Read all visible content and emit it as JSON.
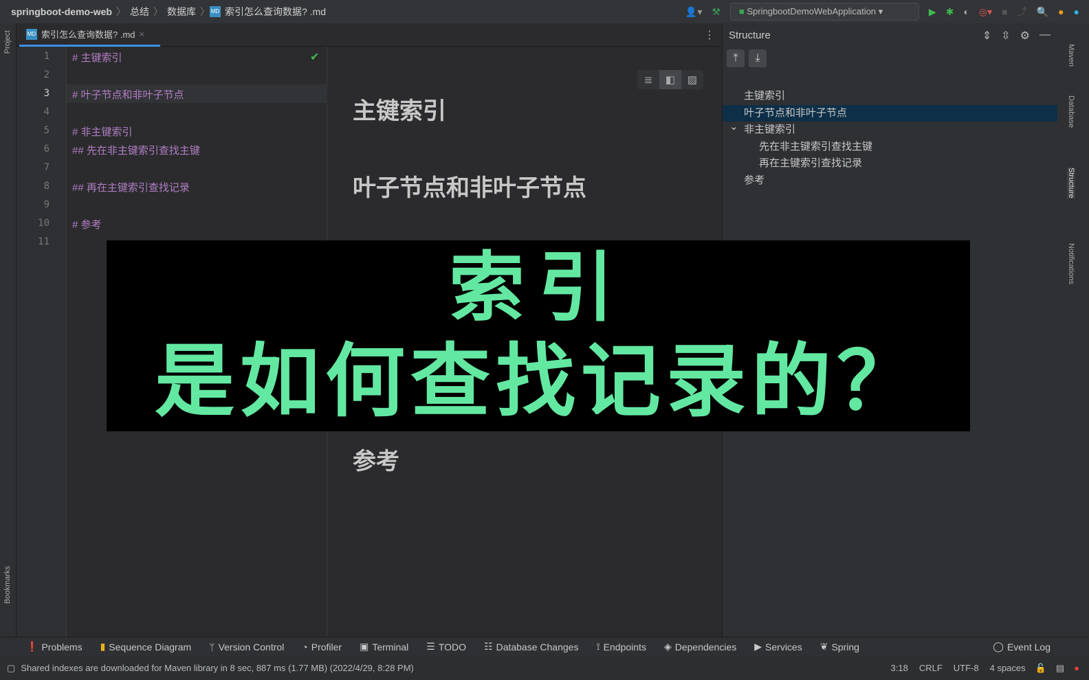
{
  "breadcrumb": [
    "springboot-demo-web",
    "总结",
    "数据库",
    "索引怎么查询数据? .md"
  ],
  "run_config": "SpringbootDemoWebApplication",
  "tab": {
    "label": "索引怎么查询数据? .md",
    "icon": "MD"
  },
  "left_strip": [
    "Project",
    "Bookmarks"
  ],
  "right_strip": [
    "Maven",
    "Database",
    "Structure",
    "Notifications"
  ],
  "editor": {
    "line_numbers": [
      "1",
      "2",
      "3",
      "4",
      "5",
      "6",
      "7",
      "8",
      "9",
      "10",
      "11"
    ],
    "lines": [
      "# 主键索引",
      "",
      "# 叶子节点和非叶子节点",
      "",
      "# 非主键索引",
      "## 先在非主键索引查找主键",
      "",
      "## 再在主键索引查找记录",
      "",
      "# 参考",
      ""
    ]
  },
  "preview": {
    "headings": [
      "主键索引",
      "叶子节点和非叶子节点",
      "参考"
    ]
  },
  "structure": {
    "title": "Structure",
    "nodes": [
      {
        "label": "主键索引",
        "level": 1
      },
      {
        "label": "叶子节点和非叶子节点",
        "level": 1,
        "selected": true
      },
      {
        "label": "非主键索引",
        "level": 1,
        "expanded": true
      },
      {
        "label": "先在非主键索引查找主键",
        "level": 2
      },
      {
        "label": "再在主键索引查找记录",
        "level": 2
      },
      {
        "label": "参考",
        "level": 1
      }
    ]
  },
  "overlay": {
    "line1": "索引",
    "line2": "是如何查找记录的？",
    "color": "#63e8a2"
  },
  "tool_windows": [
    "Problems",
    "Sequence Diagram",
    "Version Control",
    "Profiler",
    "Terminal",
    "TODO",
    "Database Changes",
    "Endpoints",
    "Dependencies",
    "Services",
    "Spring"
  ],
  "event_log": "Event Log",
  "status": {
    "message": "Shared indexes are downloaded for Maven library in 8 sec, 887 ms (1.77 MB) (2022/4/29, 8:28 PM)",
    "position": "3:18",
    "line_sep": "CRLF",
    "encoding": "UTF-8",
    "indent": "4 spaces"
  }
}
